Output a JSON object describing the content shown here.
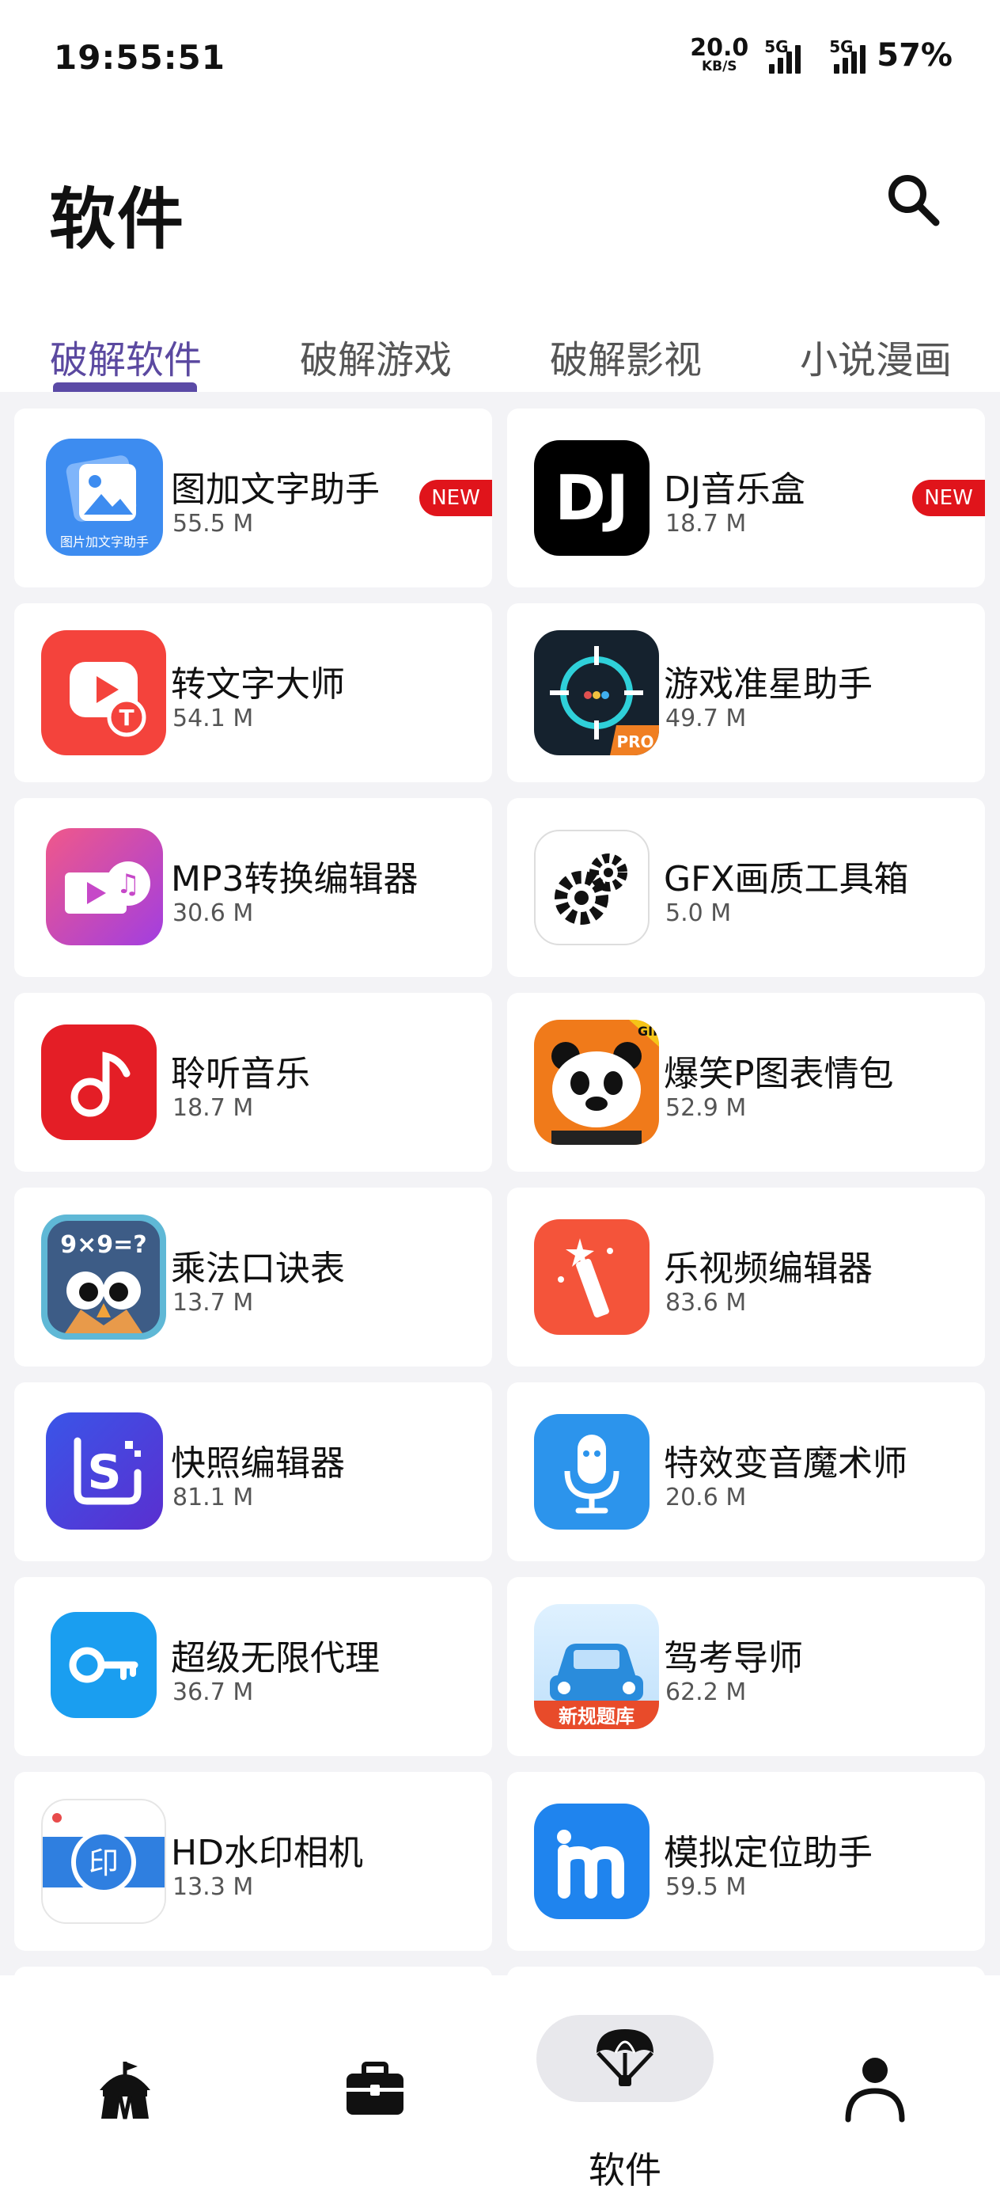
{
  "status_bar": {
    "time": "19:55:51",
    "net_speed_value": "20.0",
    "net_speed_unit": "KB/S",
    "sim1_tag": "5G",
    "sim2_tag": "5G",
    "battery": "57%"
  },
  "header": {
    "title": "软件",
    "search_icon": "search-icon"
  },
  "tabs": [
    {
      "label": "破解软件",
      "active": true
    },
    {
      "label": "破解游戏",
      "active": false
    },
    {
      "label": "破解影视",
      "active": false
    },
    {
      "label": "小说漫画",
      "active": false
    }
  ],
  "apps": [
    {
      "name": "图加文字助手",
      "size": "55.5 M",
      "badge": "NEW",
      "icon": "image-text-icon",
      "color": "#3d8cf0"
    },
    {
      "name": "DJ音乐盒",
      "size": "18.7 M",
      "badge": "NEW",
      "icon": "dj-icon",
      "color": "#000000"
    },
    {
      "name": "转文字大师",
      "size": "54.1 M",
      "icon": "video-to-text-icon",
      "color": "#f4433c"
    },
    {
      "name": "游戏准星助手",
      "size": "49.7 M",
      "icon": "crosshair-icon",
      "color": "#15222e"
    },
    {
      "name": "MP3转换编辑器",
      "size": "30.6 M",
      "icon": "music-video-icon",
      "color": "#c648c8"
    },
    {
      "name": "GFX画质工具箱",
      "size": "5.0 M",
      "icon": "gears-icon",
      "color": "#ffffff"
    },
    {
      "name": "聆听音乐",
      "size": "18.7 M",
      "icon": "music-note-icon",
      "color": "#e41e26"
    },
    {
      "name": "爆笑P图表情包",
      "size": "52.9 M",
      "icon": "panda-icon",
      "color": "#f07a1a"
    },
    {
      "name": "乘法口诀表",
      "size": "13.7 M",
      "icon": "owl-math-icon",
      "color": "#3d5c86"
    },
    {
      "name": "乐视频编辑器",
      "size": "83.6 M",
      "icon": "magic-wand-icon",
      "color": "#f4543a"
    },
    {
      "name": "快照编辑器",
      "size": "81.1 M",
      "icon": "snapshot-icon",
      "color": "#3f3fd8"
    },
    {
      "name": "特效变音魔术师",
      "size": "20.6 M",
      "icon": "microphone-icon",
      "color": "#2c94ec"
    },
    {
      "name": "超级无限代理",
      "size": "36.7 M",
      "icon": "key-icon",
      "color": "#1a9ef0"
    },
    {
      "name": "驾考导师",
      "size": "62.2 M",
      "icon": "car-icon",
      "color": "#2a8cdc"
    },
    {
      "name": "HD水印相机",
      "size": "13.3 M",
      "icon": "watermark-camera-icon",
      "color": "#2f7fe0"
    },
    {
      "name": "模拟定位助手",
      "size": "59.5 M",
      "icon": "location-m-icon",
      "color": "#1f84ee"
    }
  ],
  "icon_texts": {
    "image_text": "图片加文字助手",
    "dj": "DJ",
    "pro": "PRO",
    "gif": "GIF",
    "math": "9×9=?",
    "driving": "新规题库",
    "watermark": "印"
  },
  "bottom_nav": [
    {
      "icon": "circus-tent-icon",
      "label": "",
      "active": false
    },
    {
      "icon": "briefcase-icon",
      "label": "",
      "active": false
    },
    {
      "icon": "parachute-icon",
      "label": "软件",
      "active": true
    },
    {
      "icon": "user-icon",
      "label": "",
      "active": false
    }
  ]
}
